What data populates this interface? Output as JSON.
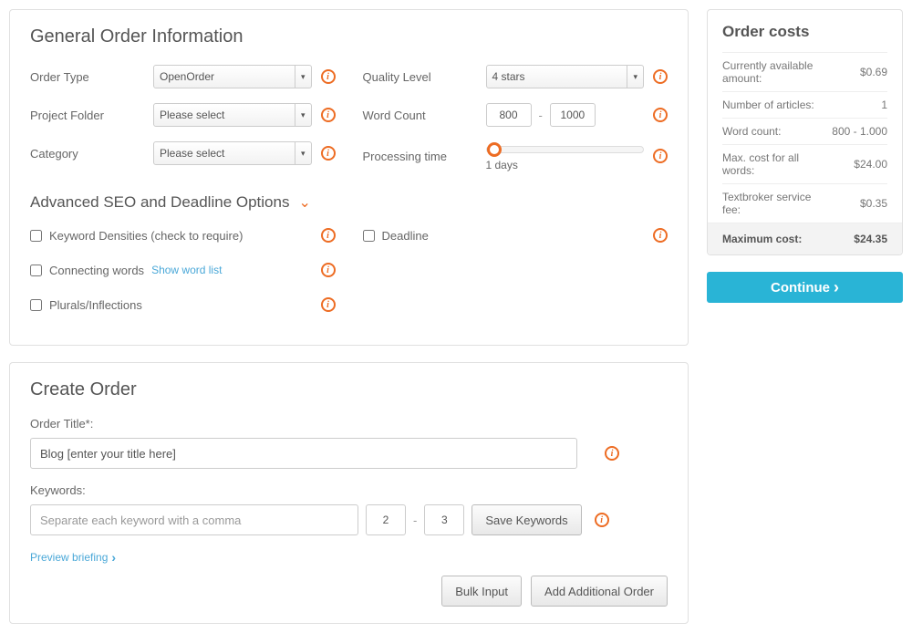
{
  "general": {
    "title": "General Order Information",
    "orderType": {
      "label": "Order Type",
      "value": "OpenOrder"
    },
    "projectFolder": {
      "label": "Project Folder",
      "value": "Please select"
    },
    "category": {
      "label": "Category",
      "value": "Please select"
    },
    "qualityLevel": {
      "label": "Quality Level",
      "value": "4 stars"
    },
    "wordCount": {
      "label": "Word Count",
      "min": "800",
      "max": "1000"
    },
    "processingTime": {
      "label": "Processing time",
      "value": "1 days"
    }
  },
  "advanced": {
    "title": "Advanced SEO and Deadline Options",
    "keywordDensities": "Keyword Densities (check to require)",
    "connectingWords": "Connecting words",
    "showWordList": "Show word list",
    "plurals": "Plurals/Inflections",
    "deadline": "Deadline"
  },
  "createOrder": {
    "title": "Create Order",
    "orderTitleLabel": "Order Title*:",
    "orderTitleValue": "Blog [enter your title here]",
    "keywordsLabel": "Keywords:",
    "keywordsPlaceholder": "Separate each keyword with a comma",
    "kwMin": "2",
    "kwMax": "3",
    "saveKeywords": "Save Keywords",
    "previewBriefing": "Preview briefing",
    "bulkInput": "Bulk Input",
    "addAdditional": "Add Additional Order"
  },
  "costs": {
    "title": "Order costs",
    "rows": [
      {
        "label": "Currently available amount:",
        "value": "$0.69"
      },
      {
        "label": "Number of articles:",
        "value": "1"
      },
      {
        "label": "Word count:",
        "value": "800 - 1.000"
      },
      {
        "label": "Max. cost for all words:",
        "value": "$24.00"
      },
      {
        "label": "Textbroker service fee:",
        "value": "$0.35"
      }
    ],
    "totalLabel": "Maximum cost:",
    "totalValue": "$24.35",
    "continue": "Continue"
  }
}
